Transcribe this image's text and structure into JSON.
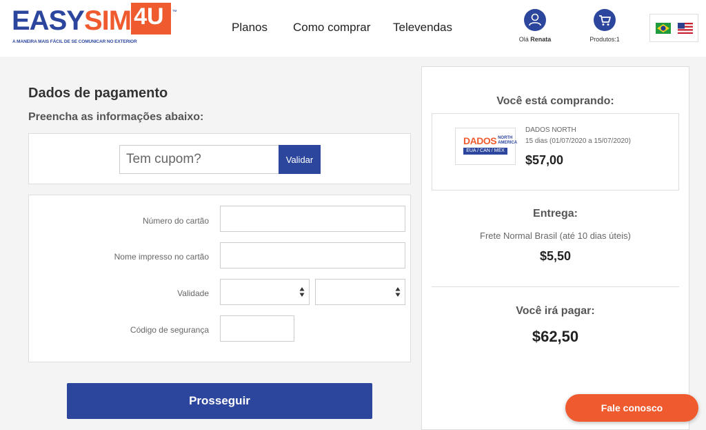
{
  "header": {
    "logo": {
      "brand_easy": "EASY",
      "brand_sim": "SIM",
      "brand_4u": "4U",
      "trademark": "™",
      "tagline": "A MANEIRA MAIS FÁCIL DE SE COMUNICAR NO EXTERIOR"
    },
    "nav": [
      {
        "label": "Planos"
      },
      {
        "label": "Como comprar"
      },
      {
        "label": "Televendas"
      }
    ],
    "user": {
      "greeting": "Olá",
      "name": "Renata",
      "icon": "user-icon"
    },
    "cart": {
      "label": "Produtos:1",
      "icon": "cart-icon"
    },
    "languages": [
      {
        "icon": "brazil-flag-icon"
      },
      {
        "icon": "usa-flag-icon"
      }
    ]
  },
  "payment": {
    "title": "Dados de pagamento",
    "subtitle": "Preencha as informações abaixo:",
    "coupon": {
      "placeholder": "Tem cupom?",
      "button": "Validar"
    },
    "fields": {
      "card_number": {
        "label": "Número do cartão",
        "value": ""
      },
      "card_name": {
        "label": "Nome impresso no cartão",
        "value": ""
      },
      "expiry": {
        "label": "Validade",
        "month": "",
        "year": ""
      },
      "cvv": {
        "label": "Código de segurança",
        "value": ""
      }
    },
    "proceed_button": "Prosseguir"
  },
  "summary": {
    "buying_title": "Você está comprando:",
    "product": {
      "logo_main": "DADOS",
      "logo_sub": "NORTH AMERICA",
      "logo_band": "EUA / CAN / MEX",
      "name": "DADOS NORTH",
      "period": "15 dias (01/07/2020 a 15/07/2020)",
      "price": "$57,00"
    },
    "delivery_title": "Entrega:",
    "delivery_method": "Frete Normal Brasil (até 10 dias úteis)",
    "delivery_price": "$5,50",
    "total_title": "Você irá pagar:",
    "total_price": "$62,50"
  },
  "chat_button": "Fale conosco",
  "colors": {
    "brand_blue": "#2c469e",
    "brand_orange": "#ef5a2f"
  }
}
